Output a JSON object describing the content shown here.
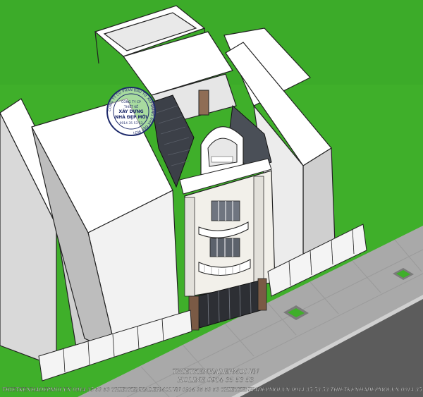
{
  "stamp": {
    "ring_text": "CÔNG TY CỔ PHẦN ĐẦU TƯ XÂY DỰNG NHÀ ĐẸP MỚI",
    "line1": "CÔNG TY CP",
    "line2": "THIẾT KẾ",
    "line3": "XÂY DỰNG",
    "line4": "NHÀ ĐẸP MỚI",
    "line5": "0914 35 53 53"
  },
  "watermark": {
    "site": "THIETKENHADEPMOI.VN",
    "hotline": "HOLINE 0914 35 53 53",
    "footer_strip": "THIETKENHADEPMOI.VN  0914 35 53 53   THIETKENHADEPMOI.VN  0914 35 53 53   THIETKENHADEPMOI.VN  0914 35 53 53   THIETKENHADEPMOI.VN  0914 35 53 53   THIETKENHADEPMOI.VN  0914 35 53 53   THIETKENHADEPMOI.VN  0914 35 53"
  },
  "colors": {
    "grass": "#3faf2a",
    "sidewalk": "#a7a7a7",
    "road": "#5e5e5e",
    "facade": "#f2f0ea",
    "dark_roof": "#3c4048",
    "gate": "#7a5a45"
  }
}
